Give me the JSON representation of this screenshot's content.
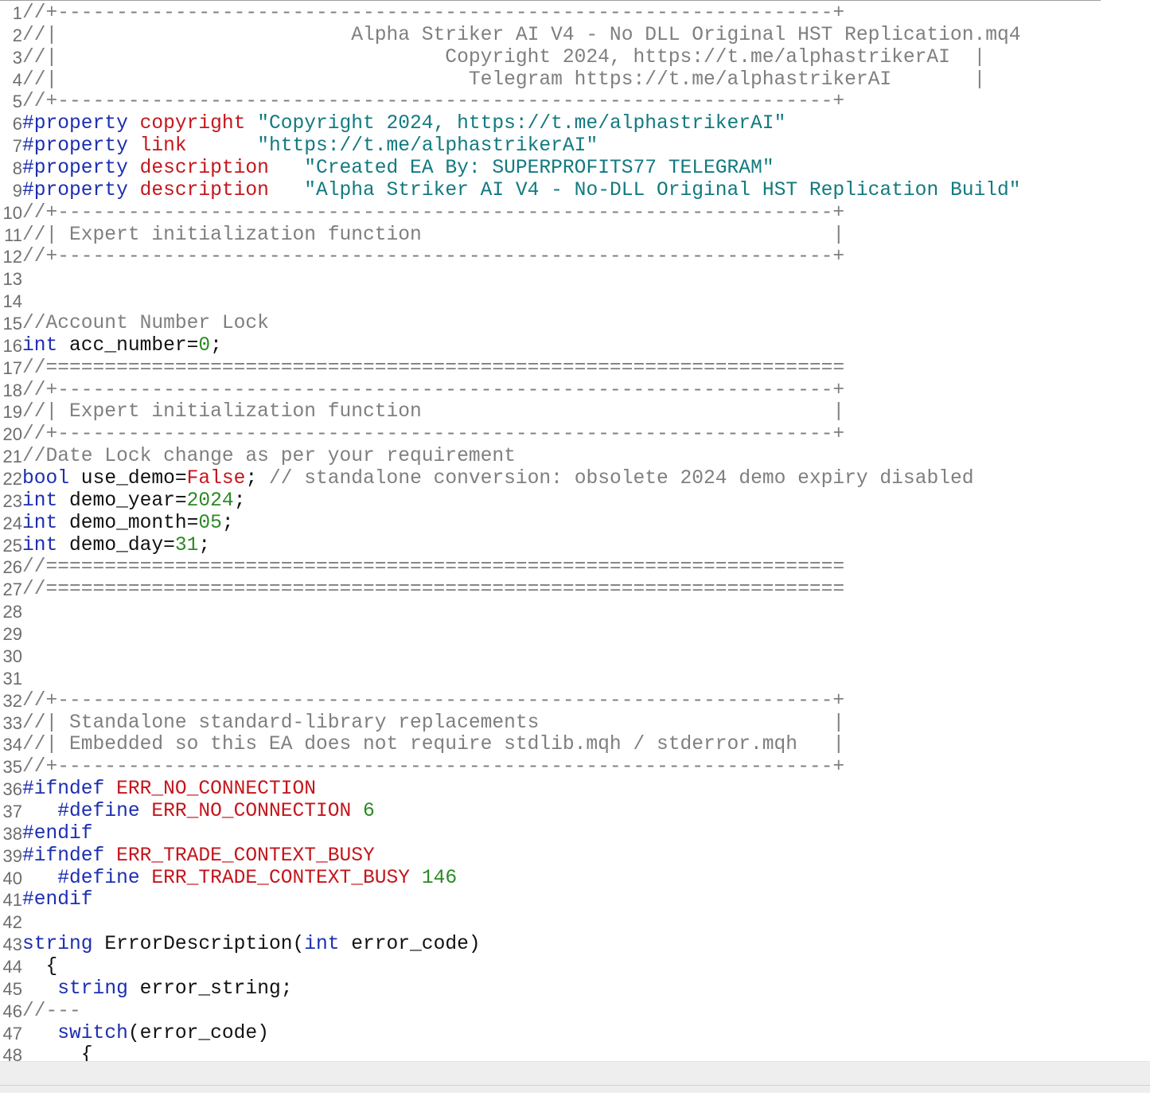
{
  "lines": [
    {
      "number": "1",
      "tokens": [
        {
          "t": "//+------------------------------------------------------------------+",
          "c": "comment"
        }
      ]
    },
    {
      "number": "2",
      "tokens": [
        {
          "t": "//|                         Alpha Striker AI V4 - No DLL Original HST Replication.mq4",
          "c": "comment"
        }
      ]
    },
    {
      "number": "3",
      "tokens": [
        {
          "t": "//|                                 Copyright 2024, https://t.me/alphastrikerAI  |",
          "c": "comment"
        }
      ]
    },
    {
      "number": "4",
      "tokens": [
        {
          "t": "//|                                   Telegram https://t.me/alphastrikerAI       |",
          "c": "comment"
        }
      ]
    },
    {
      "number": "5",
      "tokens": [
        {
          "t": "//+------------------------------------------------------------------+",
          "c": "comment"
        }
      ]
    },
    {
      "number": "6",
      "tokens": [
        {
          "t": "#property",
          "c": "directive"
        },
        {
          "t": " ",
          "c": "punct"
        },
        {
          "t": "copyright",
          "c": "property-name"
        },
        {
          "t": " ",
          "c": "punct"
        },
        {
          "t": "\"Copyright 2024, https://t.me/alphastrikerAI\"",
          "c": "string"
        }
      ]
    },
    {
      "number": "7",
      "tokens": [
        {
          "t": "#property",
          "c": "directive"
        },
        {
          "t": " ",
          "c": "punct"
        },
        {
          "t": "link",
          "c": "property-name"
        },
        {
          "t": "      ",
          "c": "punct"
        },
        {
          "t": "\"https://t.me/alphastrikerAI\"",
          "c": "string"
        }
      ]
    },
    {
      "number": "8",
      "tokens": [
        {
          "t": "#property",
          "c": "directive"
        },
        {
          "t": " ",
          "c": "punct"
        },
        {
          "t": "description",
          "c": "property-name"
        },
        {
          "t": "   ",
          "c": "punct"
        },
        {
          "t": "\"Created EA By: SUPERPROFITS77 TELEGRAM\"",
          "c": "string"
        }
      ]
    },
    {
      "number": "9",
      "tokens": [
        {
          "t": "#property",
          "c": "directive"
        },
        {
          "t": " ",
          "c": "punct"
        },
        {
          "t": "description",
          "c": "property-name"
        },
        {
          "t": "   ",
          "c": "punct"
        },
        {
          "t": "\"Alpha Striker AI V4 - No-DLL Original HST Replication Build\"",
          "c": "string"
        }
      ]
    },
    {
      "number": "10",
      "tokens": [
        {
          "t": "//+------------------------------------------------------------------+",
          "c": "comment"
        }
      ]
    },
    {
      "number": "11",
      "tokens": [
        {
          "t": "//| Expert initialization function                                   |",
          "c": "comment"
        }
      ]
    },
    {
      "number": "12",
      "tokens": [
        {
          "t": "//+------------------------------------------------------------------+",
          "c": "comment"
        }
      ]
    },
    {
      "number": "13",
      "tokens": []
    },
    {
      "number": "14",
      "tokens": []
    },
    {
      "number": "15",
      "tokens": [
        {
          "t": "//Account Number Lock",
          "c": "comment"
        }
      ]
    },
    {
      "number": "16",
      "tokens": [
        {
          "t": "int",
          "c": "keyword"
        },
        {
          "t": " acc_number=",
          "c": "ident"
        },
        {
          "t": "0",
          "c": "number"
        },
        {
          "t": ";",
          "c": "punct"
        }
      ]
    },
    {
      "number": "17",
      "tokens": [
        {
          "t": "//====================================================================",
          "c": "comment"
        }
      ]
    },
    {
      "number": "18",
      "tokens": [
        {
          "t": "//+------------------------------------------------------------------+",
          "c": "comment"
        }
      ]
    },
    {
      "number": "19",
      "tokens": [
        {
          "t": "//| Expert initialization function                                   |",
          "c": "comment"
        }
      ]
    },
    {
      "number": "20",
      "tokens": [
        {
          "t": "//+------------------------------------------------------------------+",
          "c": "comment"
        }
      ]
    },
    {
      "number": "21",
      "tokens": [
        {
          "t": "//Date Lock change as per your requirement",
          "c": "comment"
        }
      ]
    },
    {
      "number": "22",
      "tokens": [
        {
          "t": "bool",
          "c": "keyword"
        },
        {
          "t": " use_demo=",
          "c": "ident"
        },
        {
          "t": "False",
          "c": "bool"
        },
        {
          "t": "; ",
          "c": "punct"
        },
        {
          "t": "// standalone conversion: obsolete 2024 demo expiry disabled",
          "c": "comment"
        }
      ]
    },
    {
      "number": "23",
      "tokens": [
        {
          "t": "int",
          "c": "keyword"
        },
        {
          "t": " demo_year=",
          "c": "ident"
        },
        {
          "t": "2024",
          "c": "number"
        },
        {
          "t": ";",
          "c": "punct"
        }
      ]
    },
    {
      "number": "24",
      "tokens": [
        {
          "t": "int",
          "c": "keyword"
        },
        {
          "t": " demo_month=",
          "c": "ident"
        },
        {
          "t": "05",
          "c": "number"
        },
        {
          "t": ";",
          "c": "punct"
        }
      ]
    },
    {
      "number": "25",
      "tokens": [
        {
          "t": "int",
          "c": "keyword"
        },
        {
          "t": " demo_day=",
          "c": "ident"
        },
        {
          "t": "31",
          "c": "number"
        },
        {
          "t": ";",
          "c": "punct"
        }
      ]
    },
    {
      "number": "26",
      "tokens": [
        {
          "t": "//====================================================================",
          "c": "comment"
        }
      ]
    },
    {
      "number": "27",
      "tokens": [
        {
          "t": "//====================================================================",
          "c": "comment"
        }
      ]
    },
    {
      "number": "28",
      "tokens": []
    },
    {
      "number": "29",
      "tokens": []
    },
    {
      "number": "30",
      "tokens": []
    },
    {
      "number": "31",
      "tokens": []
    },
    {
      "number": "32",
      "tokens": [
        {
          "t": "//+------------------------------------------------------------------+",
          "c": "comment"
        }
      ]
    },
    {
      "number": "33",
      "tokens": [
        {
          "t": "//| Standalone standard-library replacements                         |",
          "c": "comment"
        }
      ]
    },
    {
      "number": "34",
      "tokens": [
        {
          "t": "//| Embedded so this EA does not require stdlib.mqh / stderror.mqh   |",
          "c": "comment"
        }
      ]
    },
    {
      "number": "35",
      "tokens": [
        {
          "t": "//+------------------------------------------------------------------+",
          "c": "comment"
        }
      ]
    },
    {
      "number": "36",
      "tokens": [
        {
          "t": "#ifndef",
          "c": "directive"
        },
        {
          "t": " ",
          "c": "punct"
        },
        {
          "t": "ERR_NO_CONNECTION",
          "c": "macro"
        }
      ]
    },
    {
      "number": "37",
      "tokens": [
        {
          "t": "   ",
          "c": "punct"
        },
        {
          "t": "#define",
          "c": "directive"
        },
        {
          "t": " ",
          "c": "punct"
        },
        {
          "t": "ERR_NO_CONNECTION",
          "c": "macro"
        },
        {
          "t": " ",
          "c": "punct"
        },
        {
          "t": "6",
          "c": "number"
        }
      ]
    },
    {
      "number": "38",
      "tokens": [
        {
          "t": "#endif",
          "c": "directive"
        }
      ]
    },
    {
      "number": "39",
      "tokens": [
        {
          "t": "#ifndef",
          "c": "directive"
        },
        {
          "t": " ",
          "c": "punct"
        },
        {
          "t": "ERR_TRADE_CONTEXT_BUSY",
          "c": "macro"
        }
      ]
    },
    {
      "number": "40",
      "tokens": [
        {
          "t": "   ",
          "c": "punct"
        },
        {
          "t": "#define",
          "c": "directive"
        },
        {
          "t": " ",
          "c": "punct"
        },
        {
          "t": "ERR_TRADE_CONTEXT_BUSY",
          "c": "macro"
        },
        {
          "t": " ",
          "c": "punct"
        },
        {
          "t": "146",
          "c": "number"
        }
      ]
    },
    {
      "number": "41",
      "tokens": [
        {
          "t": "#endif",
          "c": "directive"
        }
      ]
    },
    {
      "number": "42",
      "tokens": []
    },
    {
      "number": "43",
      "tokens": [
        {
          "t": "string",
          "c": "keyword"
        },
        {
          "t": " ErrorDescription(",
          "c": "ident"
        },
        {
          "t": "int",
          "c": "keyword"
        },
        {
          "t": " error_code)",
          "c": "ident"
        }
      ]
    },
    {
      "number": "44",
      "tokens": [
        {
          "t": "  {",
          "c": "punct"
        }
      ]
    },
    {
      "number": "45",
      "tokens": [
        {
          "t": "   ",
          "c": "punct"
        },
        {
          "t": "string",
          "c": "keyword"
        },
        {
          "t": " error_string;",
          "c": "ident"
        }
      ]
    },
    {
      "number": "46",
      "tokens": [
        {
          "t": "//---",
          "c": "comment"
        }
      ]
    },
    {
      "number": "47",
      "tokens": [
        {
          "t": "   ",
          "c": "punct"
        },
        {
          "t": "switch",
          "c": "keyword"
        },
        {
          "t": "(error_code)",
          "c": "ident"
        }
      ]
    },
    {
      "number": "48",
      "tokens": [
        {
          "t": "     {",
          "c": "punct"
        }
      ]
    }
  ]
}
